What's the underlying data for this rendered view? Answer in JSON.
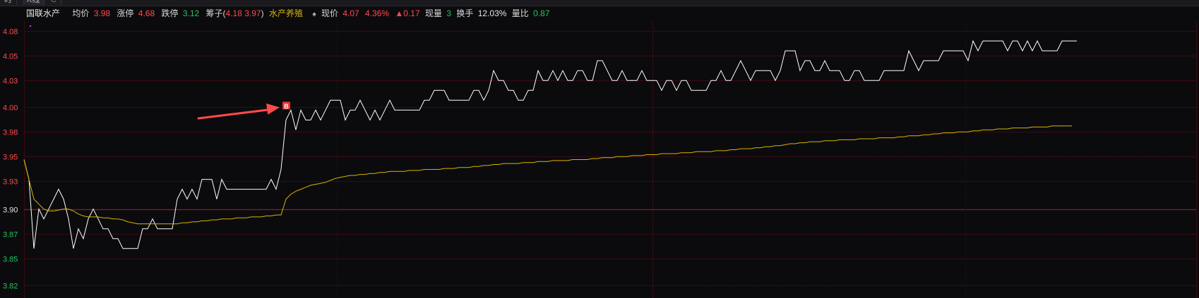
{
  "tabs": {
    "time": "时",
    "kline": "K线",
    "refresh": "C"
  },
  "info": {
    "stock_name": "国联水产",
    "avg_label": "均价",
    "avg_value": "3.98",
    "limit_up_label": "涨停",
    "limit_up_value": "4.68",
    "limit_down_label": "跌停",
    "limit_down_value": "3.12",
    "chip_label": "筹子(",
    "chip_value_1": "4.18",
    "chip_value_2": "3.97",
    "chip_close": ")",
    "sector": "水产养殖",
    "price_label": "现价",
    "price_value": "4.07",
    "pct_value": "4.36%",
    "change_value": "▲0.17",
    "volume_label": "现量",
    "volume_value": "3",
    "turnover_label": "换手",
    "turnover_value": "12.03%",
    "vol_ratio_label": "量比",
    "vol_ratio_value": "0.87"
  },
  "colors": {
    "background": "#0b0b0e",
    "grid": "#6a0a12",
    "price_line": "#ffffff",
    "avg_line": "#d7b400",
    "up_text": "#ff4a4a",
    "down_text": "#1fc85a",
    "neutral_text": "#e0e0e0",
    "arrow": "#ff4a4a",
    "buy_marker": "#e8332f"
  },
  "chart_data": {
    "type": "line",
    "title": "",
    "xlabel": "",
    "ylabel": "",
    "prev_close": 3.9,
    "ylim": [
      3.81,
      4.09
    ],
    "y_ticks": [
      "4.08",
      "4.05",
      "4.03",
      "4.00",
      "3.98",
      "3.95",
      "3.93",
      "3.90",
      "3.87",
      "3.85",
      "3.82"
    ],
    "y_tick_values": [
      4.08,
      4.055,
      4.03,
      4.003,
      3.978,
      3.953,
      3.928,
      3.9,
      3.875,
      3.85,
      3.823
    ],
    "grid": true,
    "series": [
      {
        "values": [
          3.95,
          3.93,
          3.86,
          3.9,
          3.89,
          3.9,
          3.91,
          3.92,
          3.91,
          3.89,
          3.86,
          3.88,
          3.87,
          3.89,
          3.9,
          3.89,
          3.88,
          3.88,
          3.87,
          3.87,
          3.86,
          3.86,
          3.86,
          3.86,
          3.88,
          3.88,
          3.89,
          3.88,
          3.88,
          3.88,
          3.88,
          3.91,
          3.92,
          3.91,
          3.92,
          3.91,
          3.93,
          3.93,
          3.93,
          3.91,
          3.93,
          3.92,
          3.92,
          3.92,
          3.92,
          3.92,
          3.92,
          3.92,
          3.92,
          3.92,
          3.93,
          3.92,
          3.94,
          3.99,
          4.0,
          3.98,
          4.0,
          3.99,
          3.99,
          4.0,
          3.99,
          4.0,
          4.01,
          4.01,
          4.01,
          3.99,
          4.0,
          4.0,
          4.01,
          4.0,
          3.99,
          4.0,
          3.99,
          4.0,
          4.01,
          4.0,
          4.0,
          4.0,
          4.0,
          4.0,
          4.0,
          4.01,
          4.01,
          4.02,
          4.02,
          4.02,
          4.01,
          4.01,
          4.01,
          4.01,
          4.01,
          4.02,
          4.02,
          4.01,
          4.02,
          4.04,
          4.03,
          4.03,
          4.02,
          4.02,
          4.01,
          4.01,
          4.02,
          4.02,
          4.04,
          4.03,
          4.03,
          4.04,
          4.03,
          4.04,
          4.03,
          4.03,
          4.04,
          4.04,
          4.03,
          4.03,
          4.05,
          4.05,
          4.04,
          4.03,
          4.03,
          4.04,
          4.03,
          4.03,
          4.03,
          4.04,
          4.03,
          4.03,
          4.03,
          4.02,
          4.03,
          4.03,
          4.02,
          4.03,
          4.03,
          4.02,
          4.02,
          4.02,
          4.02,
          4.03,
          4.03,
          4.04,
          4.03,
          4.03,
          4.04,
          4.05,
          4.04,
          4.03,
          4.04,
          4.04,
          4.04,
          4.04,
          4.03,
          4.04,
          4.06,
          4.06,
          4.06,
          4.04,
          4.05,
          4.05,
          4.04,
          4.04,
          4.05,
          4.04,
          4.04,
          4.04,
          4.03,
          4.03,
          4.04,
          4.04,
          4.03,
          4.03,
          4.03,
          4.03,
          4.04,
          4.04,
          4.04,
          4.04,
          4.04,
          4.06,
          4.05,
          4.04,
          4.05,
          4.05,
          4.05,
          4.05,
          4.06,
          4.06,
          4.06,
          4.06,
          4.06,
          4.05,
          4.07,
          4.06,
          4.07,
          4.07,
          4.07,
          4.07,
          4.07,
          4.06,
          4.07,
          4.07,
          4.06,
          4.07,
          4.06,
          4.07,
          4.06,
          4.06,
          4.06,
          4.06,
          4.07,
          4.07,
          4.07,
          4.07
        ]
      },
      {
        "values": [
          3.95,
          3.93,
          3.91,
          3.905,
          3.9,
          3.898,
          3.898,
          3.899,
          3.9,
          3.9,
          3.898,
          3.895,
          3.893,
          3.892,
          3.892,
          3.892,
          3.891,
          3.891,
          3.89,
          3.89,
          3.889,
          3.887,
          3.886,
          3.885,
          3.885,
          3.885,
          3.885,
          3.885,
          3.885,
          3.885,
          3.885,
          3.885,
          3.886,
          3.886,
          3.887,
          3.887,
          3.888,
          3.888,
          3.889,
          3.889,
          3.89,
          3.89,
          3.89,
          3.891,
          3.891,
          3.891,
          3.892,
          3.892,
          3.892,
          3.893,
          3.893,
          3.894,
          3.894,
          3.91,
          3.915,
          3.918,
          3.92,
          3.922,
          3.924,
          3.925,
          3.926,
          3.927,
          3.929,
          3.931,
          3.932,
          3.933,
          3.934,
          3.934,
          3.935,
          3.935,
          3.936,
          3.936,
          3.937,
          3.937,
          3.938,
          3.938,
          3.938,
          3.938,
          3.939,
          3.939,
          3.939,
          3.94,
          3.94,
          3.94,
          3.94,
          3.941,
          3.941,
          3.941,
          3.942,
          3.942,
          3.942,
          3.943,
          3.943,
          3.944,
          3.944,
          3.945,
          3.945,
          3.946,
          3.946,
          3.946,
          3.946,
          3.947,
          3.947,
          3.947,
          3.948,
          3.948,
          3.948,
          3.949,
          3.949,
          3.949,
          3.949,
          3.95,
          3.95,
          3.95,
          3.95,
          3.951,
          3.951,
          3.952,
          3.952,
          3.952,
          3.953,
          3.953,
          3.953,
          3.954,
          3.954,
          3.954,
          3.955,
          3.955,
          3.955,
          3.956,
          3.956,
          3.956,
          3.956,
          3.957,
          3.957,
          3.957,
          3.958,
          3.958,
          3.958,
          3.958,
          3.959,
          3.959,
          3.959,
          3.96,
          3.96,
          3.961,
          3.961,
          3.961,
          3.962,
          3.962,
          3.963,
          3.963,
          3.964,
          3.964,
          3.965,
          3.966,
          3.966,
          3.967,
          3.967,
          3.968,
          3.968,
          3.968,
          3.969,
          3.969,
          3.969,
          3.97,
          3.97,
          3.97,
          3.97,
          3.971,
          3.971,
          3.971,
          3.971,
          3.972,
          3.972,
          3.972,
          3.972,
          3.973,
          3.973,
          3.974,
          3.974,
          3.974,
          3.975,
          3.975,
          3.976,
          3.976,
          3.977,
          3.977,
          3.977,
          3.978,
          3.978,
          3.978,
          3.979,
          3.979,
          3.98,
          3.98,
          3.98,
          3.981,
          3.981,
          3.981,
          3.982,
          3.982,
          3.982,
          3.982,
          3.983,
          3.983,
          3.983,
          3.983,
          3.984,
          3.984,
          3.984,
          3.984,
          3.984
        ]
      }
    ],
    "buy_marker": {
      "label": "B",
      "point_index": 53,
      "price": 4.0
    },
    "annotations": [
      "arrow pointing to buy marker"
    ]
  }
}
